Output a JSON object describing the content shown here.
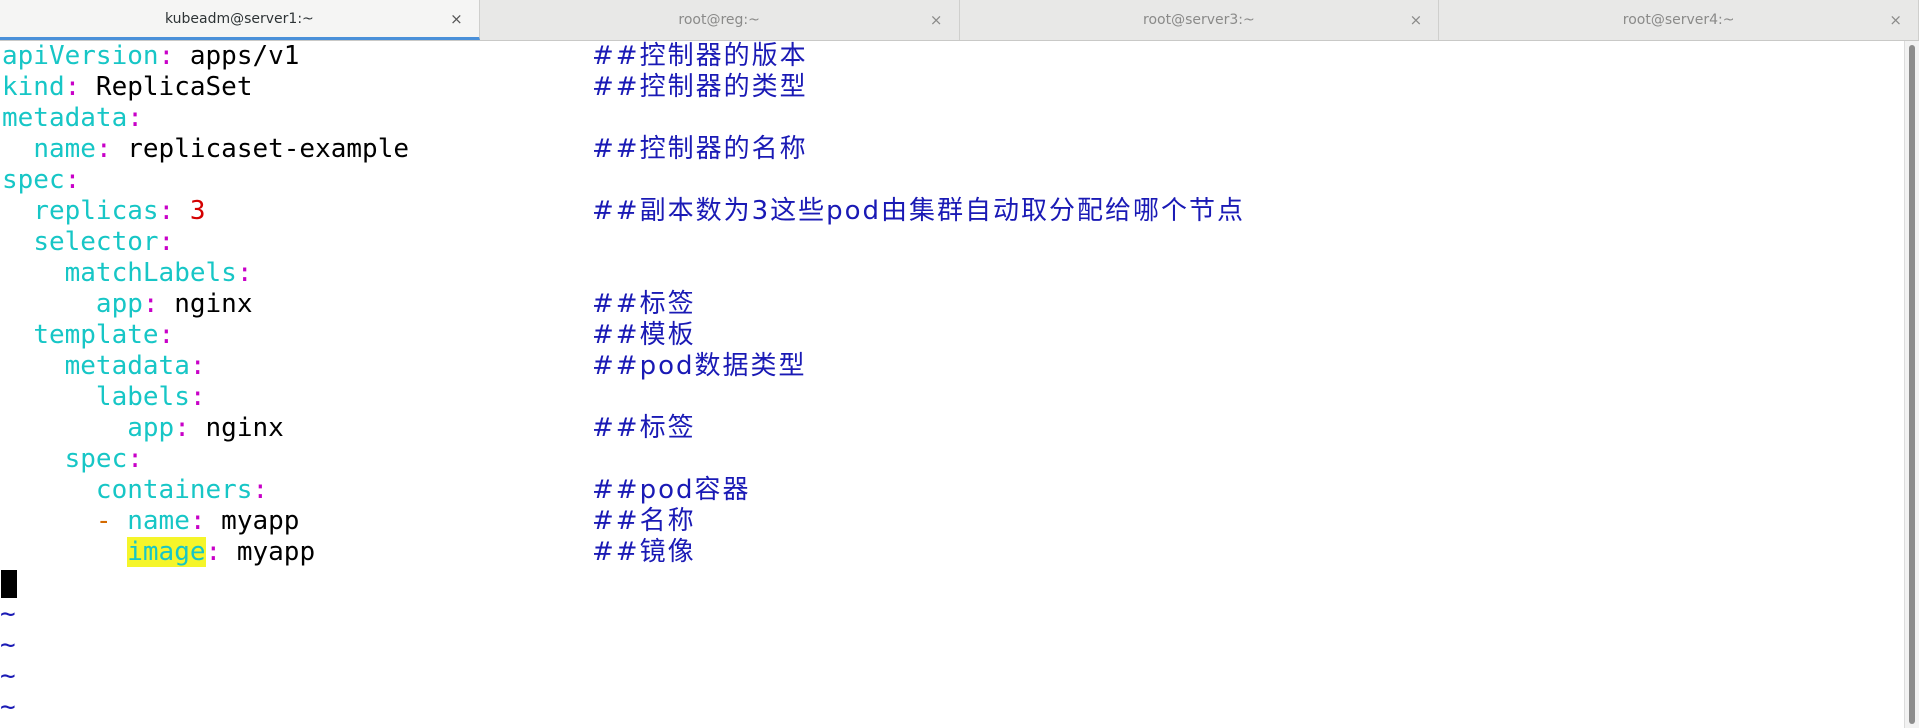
{
  "tabs": [
    {
      "label": "kubeadm@server1:~",
      "close": "×",
      "active": true
    },
    {
      "label": "root@reg:~",
      "close": "×",
      "active": false
    },
    {
      "label": "root@server3:~",
      "close": "×",
      "active": false
    },
    {
      "label": "root@server4:~",
      "close": "×",
      "active": false
    }
  ],
  "editor": {
    "lines": [
      {
        "indent": "",
        "dash": "",
        "key": "apiVersion",
        "colon": ":",
        "value": " apps/v1",
        "comment": "##控制器的版本"
      },
      {
        "indent": "",
        "dash": "",
        "key": "kind",
        "colon": ":",
        "value": " ReplicaSet",
        "comment": "##控制器的类型"
      },
      {
        "indent": "",
        "dash": "",
        "key": "metadata",
        "colon": ":",
        "value": "",
        "comment": ""
      },
      {
        "indent": "  ",
        "dash": "",
        "key": "name",
        "colon": ":",
        "value": " replicaset-example",
        "comment": "##控制器的名称"
      },
      {
        "indent": "",
        "dash": "",
        "key": "spec",
        "colon": ":",
        "value": "",
        "comment": ""
      },
      {
        "indent": "  ",
        "dash": "",
        "key": "replicas",
        "colon": ":",
        "value": " 3",
        "comment": "##副本数为3这些pod由集群自动取分配给哪个节点"
      },
      {
        "indent": "  ",
        "dash": "",
        "key": "selector",
        "colon": ":",
        "value": "",
        "comment": ""
      },
      {
        "indent": "    ",
        "dash": "",
        "key": "matchLabels",
        "colon": ":",
        "value": "",
        "comment": ""
      },
      {
        "indent": "      ",
        "dash": "",
        "key": "app",
        "colon": ":",
        "value": " nginx",
        "comment": "##标签"
      },
      {
        "indent": "  ",
        "dash": "",
        "key": "template",
        "colon": ":",
        "value": "",
        "comment": "##模板"
      },
      {
        "indent": "    ",
        "dash": "",
        "key": "metadata",
        "colon": ":",
        "value": "",
        "comment": "##pod数据类型"
      },
      {
        "indent": "      ",
        "dash": "",
        "key": "labels",
        "colon": ":",
        "value": "",
        "comment": ""
      },
      {
        "indent": "        ",
        "dash": "",
        "key": "app",
        "colon": ":",
        "value": " nginx",
        "comment": "##标签"
      },
      {
        "indent": "    ",
        "dash": "",
        "key": "spec",
        "colon": ":",
        "value": "",
        "comment": ""
      },
      {
        "indent": "      ",
        "dash": "",
        "key": "containers",
        "colon": ":",
        "value": "",
        "comment": "##pod容器"
      },
      {
        "indent": "      ",
        "dash": "- ",
        "key": "name",
        "colon": ":",
        "value": " myapp",
        "comment": "##名称"
      },
      {
        "indent": "        ",
        "dash": "",
        "key": "image",
        "colon": ":",
        "value": " myapp",
        "comment": "##镜像",
        "highlight": true
      }
    ],
    "empty_line_markers": [
      "~",
      "~",
      "~",
      "~"
    ]
  },
  "colors": {
    "key": "#17c6c6",
    "colon": "#c800c8",
    "number": "#d40000",
    "comment": "#1a1ab5",
    "search_highlight": "#f5f52a",
    "active_tab_indicator": "#4a90d9"
  }
}
